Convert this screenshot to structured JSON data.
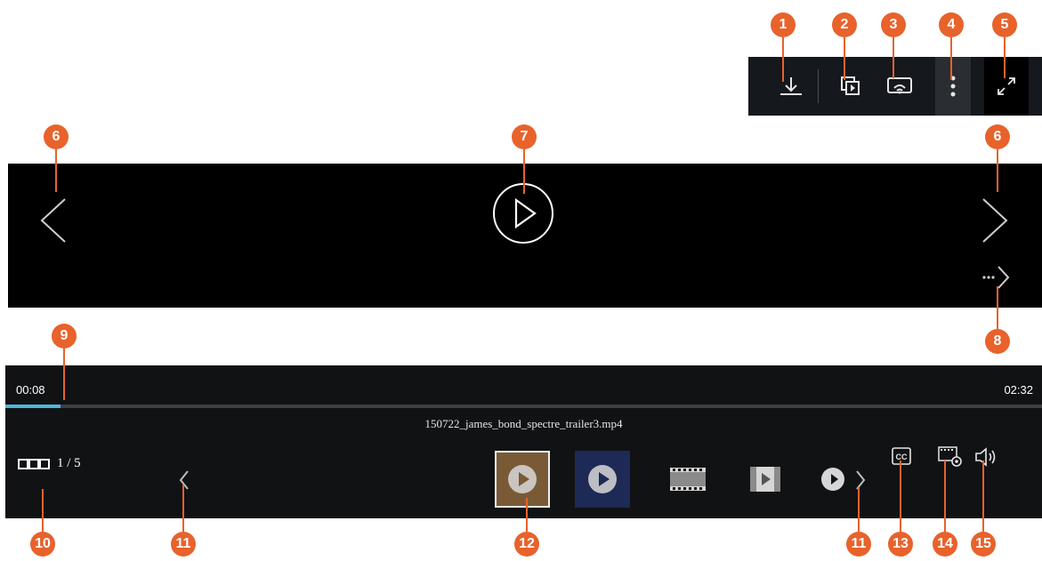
{
  "toolbar": {
    "items": [
      {
        "icon": "download-icon",
        "number": "1"
      },
      {
        "icon": "slideshow-icon",
        "number": "2"
      },
      {
        "icon": "cast-icon",
        "number": "3"
      },
      {
        "icon": "more-vertical-icon",
        "number": "4"
      },
      {
        "icon": "fullscreen-icon",
        "number": "5"
      }
    ]
  },
  "viewer": {
    "prev_marker": "6",
    "next_marker": "6",
    "play_marker": "7",
    "more_marker": "8",
    "play_icon": "play-icon",
    "more_icon": "more-arrow-icon"
  },
  "player": {
    "current_time": "00:08",
    "total_time": "02:32",
    "progress_fraction": 0.053,
    "file_name": "150722_james_bond_spectre_trailer3.mp4",
    "progress_marker": "9"
  },
  "gallery": {
    "counter_current": "1",
    "counter_total": "5",
    "counter_text": "1 / 5",
    "counter_marker": "10",
    "prev_marker": "11",
    "next_marker": "11",
    "thumbs_marker": "12",
    "thumbnails": [
      {
        "type": "video",
        "selected": true
      },
      {
        "type": "video",
        "selected": false
      },
      {
        "type": "film",
        "selected": false
      },
      {
        "type": "video-file",
        "selected": false
      },
      {
        "type": "partial",
        "selected": false
      }
    ]
  },
  "controls": [
    {
      "icon": "closed-caption-icon",
      "label": "CC",
      "number": "13"
    },
    {
      "icon": "video-settings-icon",
      "number": "14"
    },
    {
      "icon": "volume-icon",
      "number": "15"
    }
  ],
  "colors": {
    "marker": "#e8622c",
    "progress": "#4fb6d8",
    "bar_background": "#111214",
    "viewer_background": "#000000"
  }
}
